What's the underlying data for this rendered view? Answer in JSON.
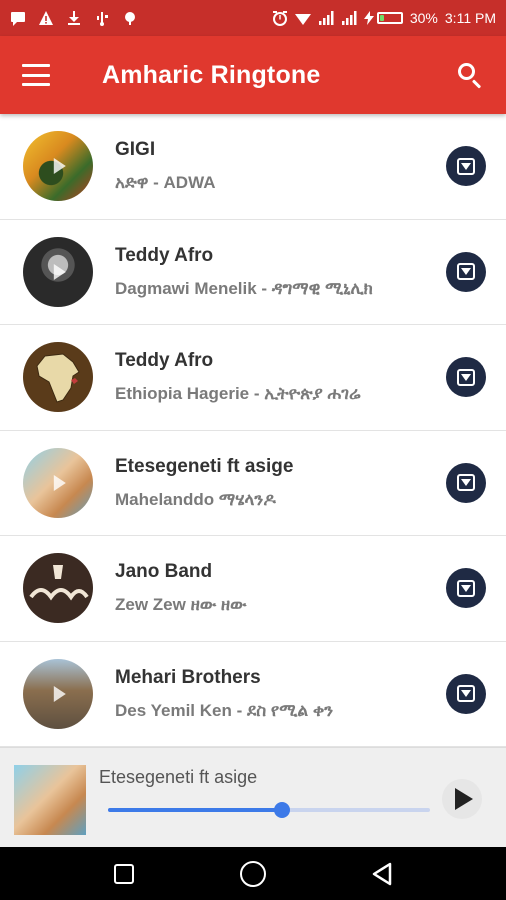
{
  "status_bar": {
    "battery_percent": "30%",
    "battery_level": 0.3,
    "time": "3:11 PM",
    "left_icons": [
      "message-icon",
      "warning-icon",
      "download-icon",
      "usb-icon",
      "android-icon"
    ],
    "right_icons": [
      "alarm-icon",
      "wifi-icon",
      "signal-icon",
      "signal-icon",
      "charging-icon"
    ]
  },
  "app_bar": {
    "title": "Amharic Ringtone",
    "color": "#e0382e"
  },
  "songs": [
    {
      "title": "GIGI",
      "subtitle": "አድዋ - ADWA",
      "art": "gigi"
    },
    {
      "title": "Teddy Afro",
      "subtitle": "Dagmawi Menelik - ዳግማዊ ሚኒሊክ",
      "art": "teddy1"
    },
    {
      "title": "Teddy Afro",
      "subtitle": "Ethiopia Hagerie  - ኢትዮጵያ ሐገሬ",
      "art": "africa"
    },
    {
      "title": "Etesegeneti ft asige",
      "subtitle": "Mahelanddo ማሄላንዶ",
      "art": "ete"
    },
    {
      "title": "Jano Band",
      "subtitle": "Zew Zew ዘው ዘው",
      "art": "jano"
    },
    {
      "title": "Mehari Brothers",
      "subtitle": "Des Yemil Ken  -  ደስ የሚል ቀን",
      "art": "mehari"
    }
  ],
  "player": {
    "now_playing": "Etesegeneti ft asige",
    "progress": 0.54,
    "accent": "#3d7ae8"
  },
  "nav": {
    "buttons": [
      "recent-apps",
      "home",
      "back"
    ]
  }
}
